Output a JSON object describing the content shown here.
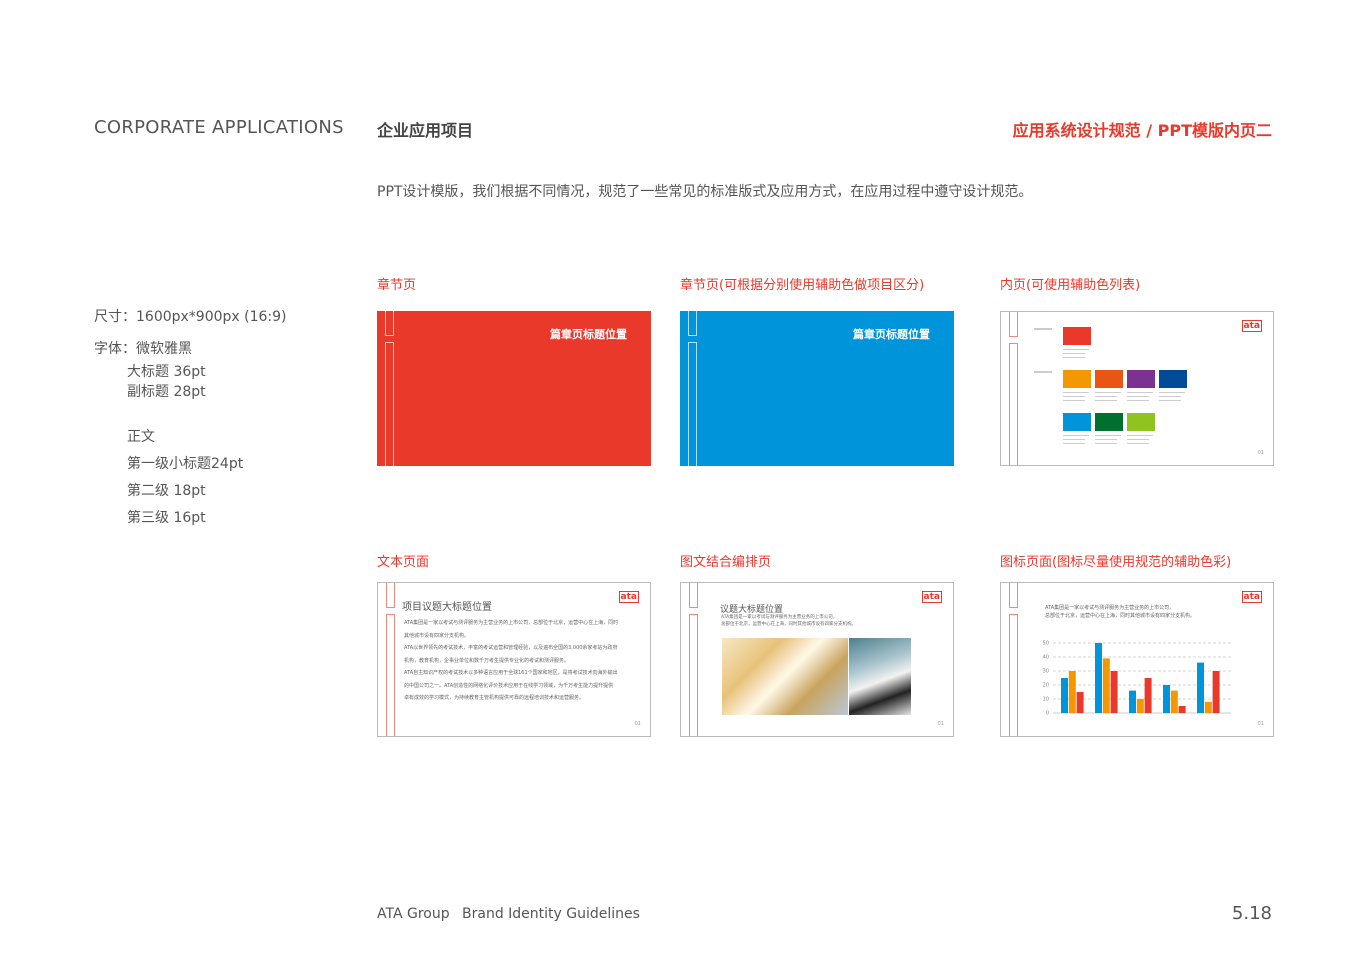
{
  "header": {
    "en_title": "CORPORATE APPLICATIONS",
    "cn_title": "企业应用项目",
    "section_title": "应用系统设计规范 / PPT模版内页二"
  },
  "intro": "PPT设计模版，我们根据不同情况，规范了一些常见的标准版式及应用方式，在应用过程中遵守设计规范。",
  "specs": {
    "size": "尺寸：1600px*900px (16:9)",
    "font": "字体：微软雅黑",
    "title": "大标题  36pt",
    "subtitle": "副标题  28pt",
    "body": "正文",
    "level1": "第一级小标题24pt",
    "level2": "第二级 18pt",
    "level3": "第三级 16pt"
  },
  "slides": [
    {
      "label": "章节页",
      "title": "篇章页标题位置",
      "color": "#e8392a"
    },
    {
      "label": "章节页(可根据分别使用辅助色做项目区分)",
      "title": "篇章页标题位置",
      "color": "#0095db"
    },
    {
      "label": "内页(可使用辅助色列表)",
      "primary": "#e8392a",
      "secondary": [
        "#f39800",
        "#ea5514",
        "#7d3191",
        "#004b98",
        "#0095db",
        "#00702f",
        "#8fc31f"
      ]
    },
    {
      "label": "文本页面",
      "title": "项目议题大标题位置",
      "body": [
        "ATA集团是一家以考试与测评服务为主营业务的上市公司，总部位于北京，运营中心在上海，同时",
        "其他城市设有四家分支机构。",
        "ATA以世界领先的考试技术，丰富的考试运营和管理经验，以及遍布全国的3,000余家考站为政府",
        "机构，教育机构，企事业单位和数千万考生提供专业化的考试和测评服务。",
        "ATA自主知识产权的考试技术以多种语言应用于全球161个国家和地区，是将考试技术向海外输出",
        "的中国公司之一。ATA创造性的网络化评价技术应用于在线学习领域，为千万考生能力提升提供",
        "卓有成效的学习模式，为持续教育主管机构提供可靠的远程培训技术和运营服务。"
      ]
    },
    {
      "label": "图文结合编排页",
      "title": "议题大标题位置",
      "body": [
        "ATA集团是一家以考试与测评服务为主营业务的上市公司，",
        "总部位于北京，运营中心在上海，同时其他城市设有四家分支机构。"
      ]
    },
    {
      "label": "图标页面(图标尽量使用规范的辅助色彩)",
      "body": [
        "ATA集团是一家以考试与测评服务为主营业务的上市公司，",
        "总部位于北京，运营中心在上海，同时其他城市设有四家分支机构。"
      ]
    }
  ],
  "logo_text": "ata",
  "slide_page": "01",
  "chart_data": {
    "type": "bar",
    "categories": [
      "1",
      "2",
      "3",
      "4",
      "5"
    ],
    "series": [
      {
        "values": [
          25,
          50,
          16,
          20,
          36
        ],
        "color": "#0095db"
      },
      {
        "values": [
          30,
          39,
          10,
          16,
          8
        ],
        "color": "#f39800"
      },
      {
        "values": [
          15,
          30,
          25,
          5,
          30
        ],
        "color": "#e8392a"
      }
    ],
    "ylim": [
      0,
      50
    ],
    "yticks": [
      0,
      10,
      20,
      30,
      40,
      50
    ],
    "grid": true
  },
  "footer": {
    "company": "ATA Group",
    "doc": "Brand Identity Guidelines",
    "page": "5.18"
  }
}
